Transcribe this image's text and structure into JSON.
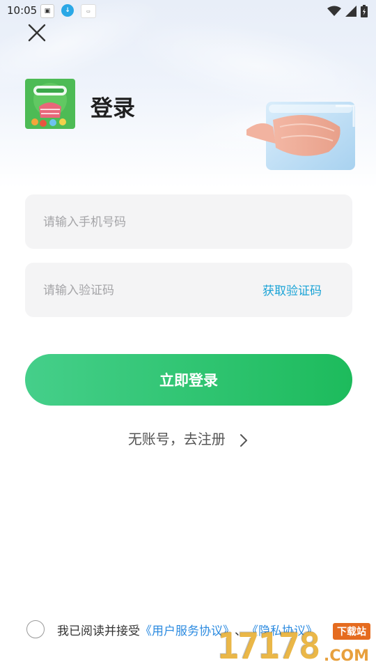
{
  "status_bar": {
    "time": "10:05",
    "app_icons": [
      "notification-app-icon",
      "download-icon",
      "notification-banner-icon"
    ],
    "right_icons": [
      "wifi-icon",
      "cell-signal-icon",
      "battery-icon"
    ]
  },
  "header": {
    "close_icon": "close-icon",
    "title": "登录"
  },
  "form": {
    "phone_placeholder": "请输入手机号码",
    "phone_value": "",
    "code_placeholder": "请输入验证码",
    "code_value": "",
    "get_code_label": "获取验证码"
  },
  "actions": {
    "login_label": "立即登录",
    "register_label": "无账号，去注册"
  },
  "agreement": {
    "prefix": "我已阅读并接受",
    "service_link": "《用户服务协议》",
    "separator": "、",
    "privacy_link": "《隐私协议》",
    "checked": false
  },
  "watermark": {
    "digits": "17178",
    "badge": "下载站",
    "suffix": ".COM"
  },
  "colors": {
    "primary_green_start": "#45cf8a",
    "primary_green_end": "#1dbb5c",
    "link_blue": "#2c8be0",
    "code_link_blue": "#1aa3d6",
    "field_bg": "#f4f4f5"
  }
}
